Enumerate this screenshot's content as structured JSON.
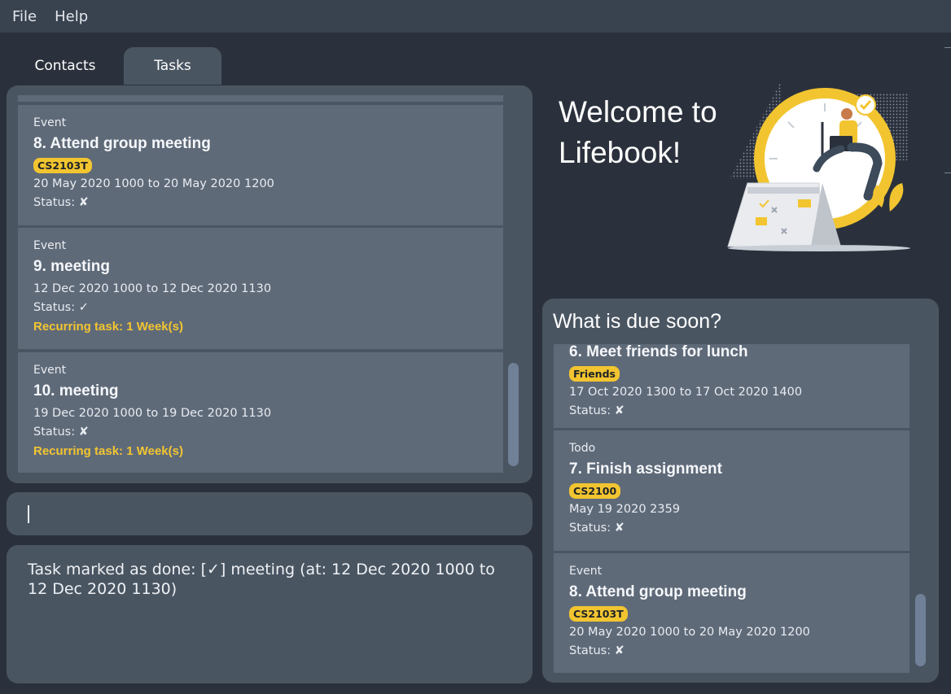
{
  "menu": {
    "file": "File",
    "help": "Help"
  },
  "tabs": {
    "contacts": "Contacts",
    "tasks": "Tasks"
  },
  "task_list": [
    {
      "type": "Event",
      "title": "8.  Attend group meeting",
      "tag": "CS2103T",
      "date": "20 May 2020 1000 to 20 May 2020 1200",
      "status": "Status: ✘",
      "recurring": ""
    },
    {
      "type": "Event",
      "title": "9.  meeting",
      "tag": "",
      "date": "12 Dec 2020 1000 to 12 Dec 2020 1130",
      "status": "Status: ✓",
      "recurring": "Recurring task: 1 Week(s)"
    },
    {
      "type": "Event",
      "title": "10.  meeting",
      "tag": "",
      "date": "19 Dec 2020 1000 to 19 Dec 2020 1130",
      "status": "Status: ✘",
      "recurring": "Recurring task: 1 Week(s)"
    }
  ],
  "command_box": {
    "value": ""
  },
  "result": {
    "text": "Task marked as done: [✓] meeting (at: 12 Dec 2020 1000 to 12 Dec 2020 1130)"
  },
  "welcome": {
    "line1": "Welcome to",
    "line2": "Lifebook!"
  },
  "due_soon": {
    "title": "What is due soon?",
    "items": [
      {
        "type": "",
        "title": "6.  Meet friends for lunch",
        "tag": "Friends",
        "date": "17 Oct 2020 1300 to 17 Oct 2020 1400",
        "status": "Status: ✘"
      },
      {
        "type": "Todo",
        "title": "7.  Finish assignment",
        "tag": "CS2100",
        "date": "May 19 2020 2359",
        "status": "Status: ✘"
      },
      {
        "type": "Event",
        "title": "8.  Attend group meeting",
        "tag": "CS2103T",
        "date": "20 May 2020 1000 to 20 May 2020 1200",
        "status": "Status: ✘"
      }
    ]
  },
  "colors": {
    "accent": "#f2c530",
    "panel": "#4a5562",
    "card": "#5f6a79",
    "background": "#2b313c"
  },
  "icons": {
    "illustration": "clock-calendar-person-illustration"
  }
}
